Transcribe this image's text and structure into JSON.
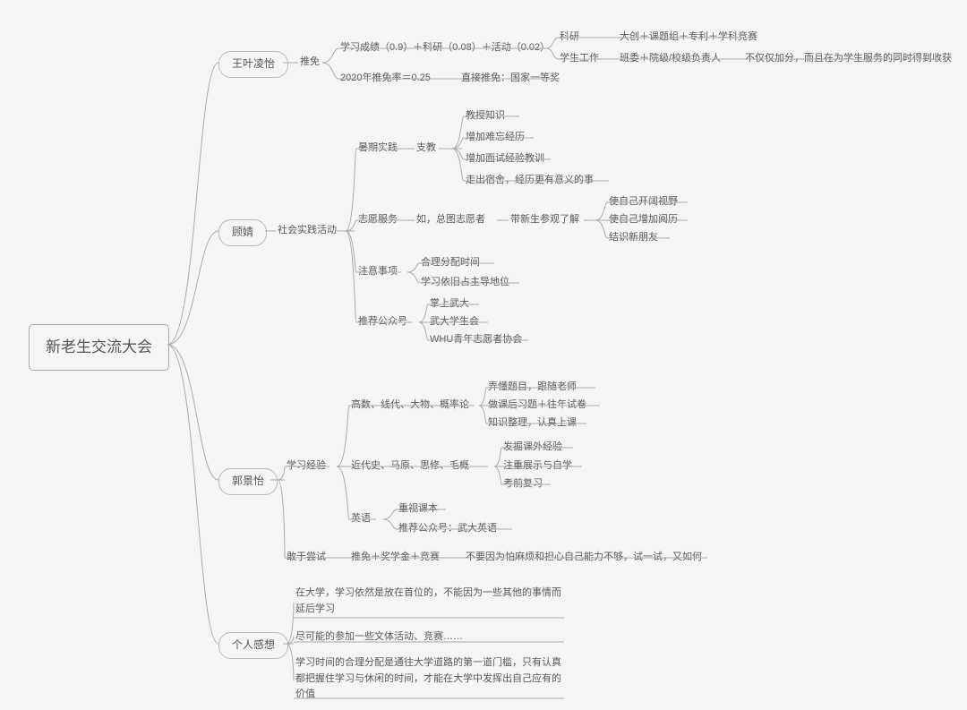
{
  "root": "新老生交流大会",
  "b1": {
    "name": "王叶凌怡",
    "l3": "推免",
    "items": {
      "a": "学习成绩（0.9）＋科研（0.08）＋活动（0.02）",
      "a1": "科研",
      "a1d": "大创＋课题组＋专利＋学科竞赛",
      "a2": "学生工作",
      "a2d": "班委＋院级/校级负责人",
      "a2e": "不仅仅加分，而且在为学生服务的同时得到收获",
      "b": "2020年推免率＝0.25",
      "bd": "直接推免：国家一等奖"
    }
  },
  "b2": {
    "name": "顾婧",
    "l3": "社会实践活动",
    "summer": {
      "t": "暑期实践",
      "t2": "支教",
      "i1": "教授知识",
      "i2": "增加难忘经历",
      "i3": "增加面试经验教训",
      "i4": "走出宿舍，经历更有意义的事"
    },
    "vol": {
      "t": "志愿服务",
      "t2": "如，总图志愿者",
      "t3": "带新生参观了解",
      "i1": "使自己开阔视野",
      "i2": "使自己增加阅历",
      "i3": "结识新朋友"
    },
    "note": {
      "t": "注意事项",
      "i1": "合理分配时间",
      "i2": "学习依旧占主导地位"
    },
    "wx": {
      "t": "推荐公众号",
      "i1": "掌上武大",
      "i2": "武大学生会",
      "i3": "WHU青年志愿者协会"
    }
  },
  "b3": {
    "name": "郭景怡",
    "l3a": "学习经验",
    "math": {
      "t": "高数、线代、大物、概率论",
      "i1": "弄懂题目，跟随老师",
      "i2": "做课后习题＋往年试卷",
      "i3": "知识整理，认真上课"
    },
    "pol": {
      "t": "近代史、马原、思修、毛概",
      "i1": "发掘课外经验",
      "i2": "注重展示与自学",
      "i3": "考前复习"
    },
    "eng": {
      "t": "英语",
      "i1": "重视课本",
      "i2": "推荐公众号：武大英语"
    },
    "l3b": "敢于尝试",
    "l3bd": "推免＋奖学金＋竞赛",
    "l3be": "不要因为怕麻烦和担心自己能力不够，试一试，又如何"
  },
  "b4": {
    "name": "个人感想",
    "i1": "在大学，学习依然是放在首位的，不能因为一些其他的事情而延后学习",
    "i2": "尽可能的参加一些文体活动、竞赛……",
    "i3": "学习时间的合理分配是通往大学道路的第一道门槛，只有认真都把握住学习与休闲的时间，才能在大学中发挥出自己应有的价值"
  }
}
